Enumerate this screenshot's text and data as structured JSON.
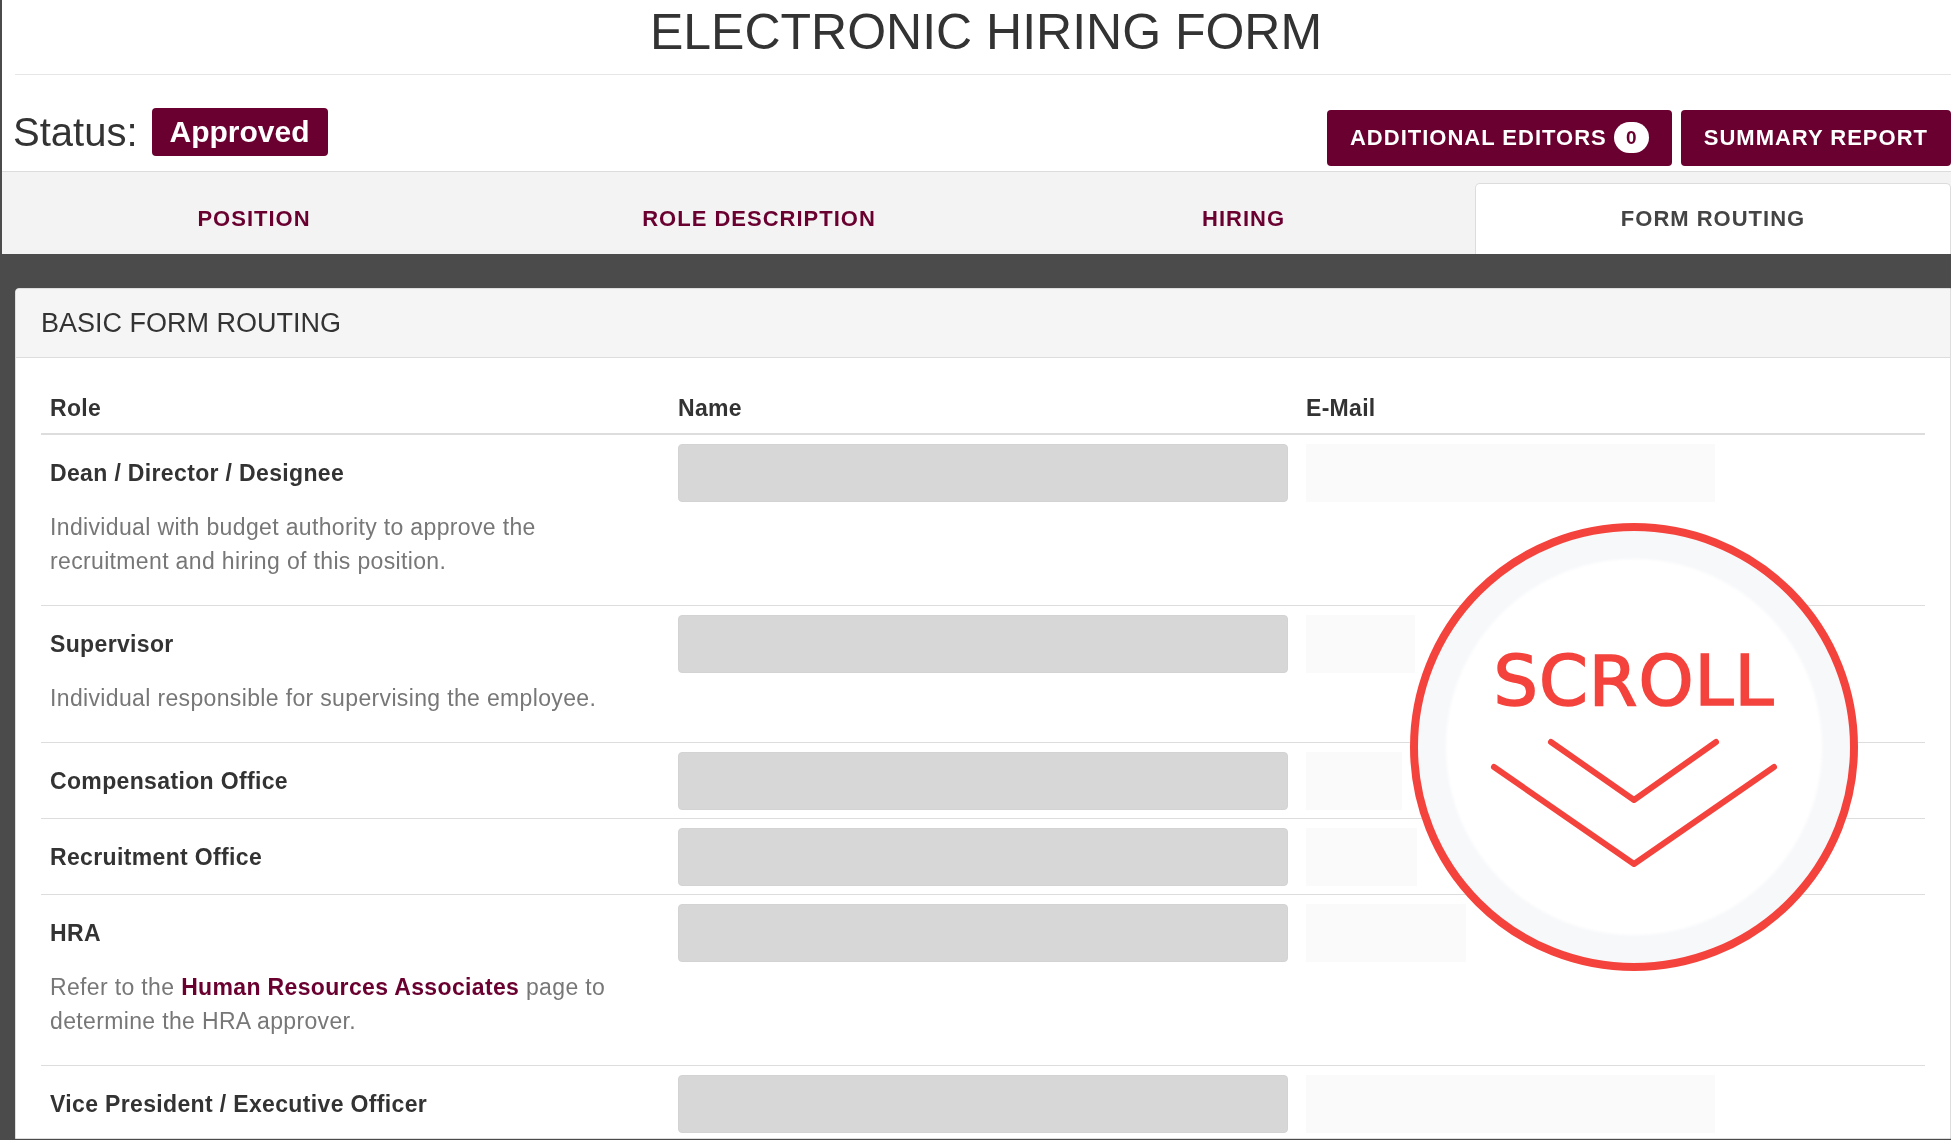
{
  "title": "ELECTRONIC HIRING FORM",
  "status": {
    "label": "Status:",
    "value": "Approved"
  },
  "buttons": [
    {
      "label": "ADDITIONAL EDITORS",
      "count": "0"
    },
    {
      "label": "SUMMARY REPORT"
    }
  ],
  "tabs": [
    {
      "label": "POSITION",
      "selected": false
    },
    {
      "label": "ROLE DESCRIPTION",
      "selected": false
    },
    {
      "label": "HIRING",
      "selected": false
    },
    {
      "label": "FORM ROUTING",
      "selected": true
    }
  ],
  "panel": {
    "title": "BASIC FORM ROUTING",
    "table": {
      "columns": [
        "Role",
        "Name",
        "E-Mail"
      ],
      "rows": [
        {
          "role": "Dean / Director / Designee",
          "description": "Individual with budget authority to approve the recruitment and hiring of this position.",
          "disabled": true
        },
        {
          "role": "Supervisor",
          "description": "Individual responsible for supervising the employee.",
          "disabled": true
        },
        {
          "role": "Compensation Office",
          "disabled": true
        },
        {
          "role": "Recruitment Office",
          "disabled": true
        },
        {
          "role": "HRA",
          "description_parts": [
            {
              "kind": "text",
              "text": "Refer to the"
            },
            {
              "kind": "link",
              "text": "Human Resources Associates"
            },
            {
              "kind": "text",
              "text": "page to determine the HRA approver."
            }
          ],
          "disabled": true
        },
        {
          "role": "Vice President / Executive Officer",
          "disabled": true
        }
      ]
    }
  },
  "scroll_hint": {
    "label": "SCROLL"
  }
}
